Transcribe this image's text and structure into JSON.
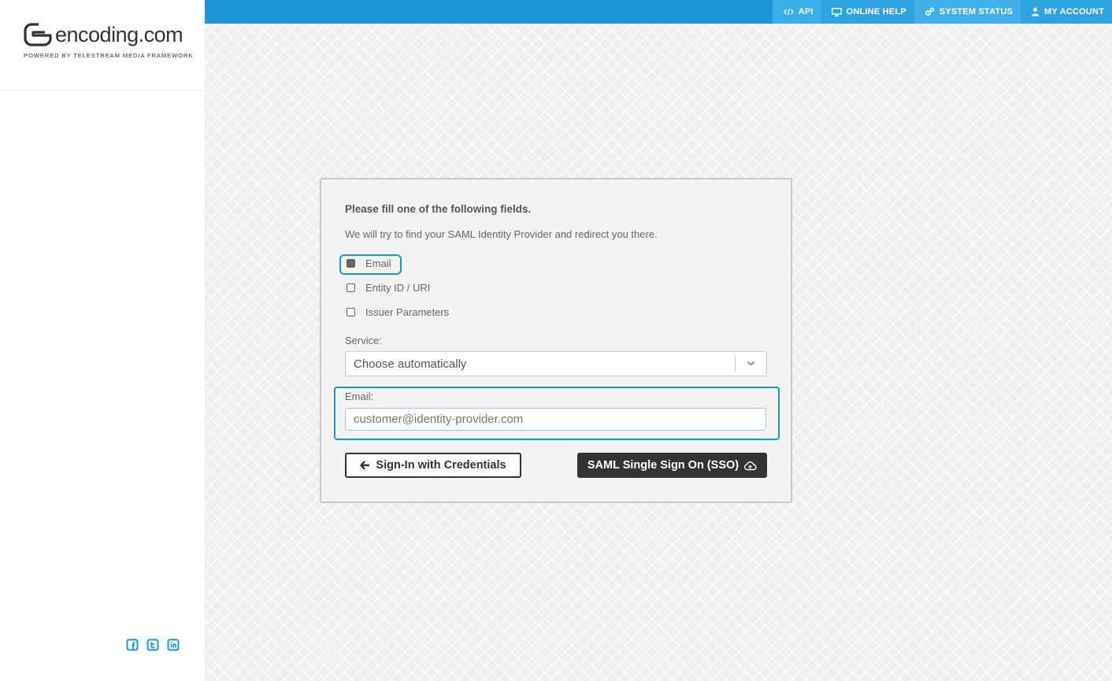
{
  "brand": {
    "name": "encoding.com",
    "tagline": "POWERED BY TELESTREAM MEDIA FRAMEWORK"
  },
  "topnav": {
    "items": [
      {
        "label": "API",
        "icon": "code-icon"
      },
      {
        "label": "ONLINE HELP",
        "icon": "monitor-icon"
      },
      {
        "label": "SYSTEM STATUS",
        "icon": "gears-icon"
      },
      {
        "label": "MY ACCOUNT",
        "icon": "user-icon"
      }
    ]
  },
  "form": {
    "title": "Please fill one of the following fields.",
    "description": "We will try to find your SAML Identity Provider and redirect you there.",
    "options": [
      {
        "label": "Email",
        "checked": true
      },
      {
        "label": "Entity ID / URI",
        "checked": false
      },
      {
        "label": "Issuer Parameters",
        "checked": false
      }
    ],
    "service": {
      "label": "Service:",
      "value": "Choose automatically"
    },
    "email": {
      "label": "Email:",
      "placeholder": "customer@identity-provider.com",
      "value": ""
    },
    "buttons": {
      "credentials": "Sign-In with Credentials",
      "sso": "SAML Single Sign On (SSO)"
    }
  },
  "social": [
    "facebook-icon",
    "twitter-icon",
    "linkedin-icon"
  ],
  "colors": {
    "accent": "#1e96d6",
    "dark_button": "#333333"
  }
}
